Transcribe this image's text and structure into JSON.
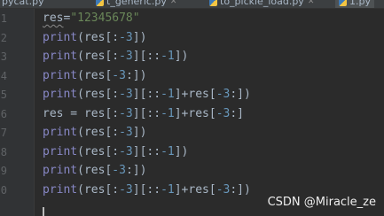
{
  "tabs": [
    {
      "label": "pycat.py"
    },
    {
      "label": "t_generic.py"
    },
    {
      "label": "to_pickle_load.py"
    },
    {
      "label": "1.py"
    }
  ],
  "gutter": {
    "line_numbers": [
      "1",
      "2",
      "3",
      "4",
      "5",
      "6",
      "7",
      "8",
      "9",
      "0"
    ]
  },
  "code_lines": [
    {
      "parts": [
        {
          "t": "res",
          "c": "plain",
          "squiggle": true
        },
        {
          "t": "=",
          "c": "plain"
        },
        {
          "t": "\"12345678\"",
          "c": "str"
        }
      ]
    },
    {
      "parts": [
        {
          "t": "print",
          "c": "fn"
        },
        {
          "t": "(res[:",
          "c": "plain"
        },
        {
          "t": "-3",
          "c": "num"
        },
        {
          "t": "])",
          "c": "plain"
        }
      ]
    },
    {
      "parts": [
        {
          "t": "print",
          "c": "fn"
        },
        {
          "t": "(res[:",
          "c": "plain"
        },
        {
          "t": "-3",
          "c": "num"
        },
        {
          "t": "][::",
          "c": "plain"
        },
        {
          "t": "-1",
          "c": "num"
        },
        {
          "t": "])",
          "c": "plain"
        }
      ]
    },
    {
      "parts": [
        {
          "t": "print",
          "c": "fn"
        },
        {
          "t": "(res[",
          "c": "plain"
        },
        {
          "t": "-3",
          "c": "num"
        },
        {
          "t": ":])",
          "c": "plain"
        }
      ]
    },
    {
      "parts": [
        {
          "t": "print",
          "c": "fn"
        },
        {
          "t": "(res[:",
          "c": "plain"
        },
        {
          "t": "-3",
          "c": "num"
        },
        {
          "t": "][::",
          "c": "plain"
        },
        {
          "t": "-1",
          "c": "num"
        },
        {
          "t": "]+res[",
          "c": "plain"
        },
        {
          "t": "-3",
          "c": "num"
        },
        {
          "t": ":])",
          "c": "plain"
        }
      ]
    },
    {
      "parts": [
        {
          "t": "res = res[:",
          "c": "plain"
        },
        {
          "t": "-3",
          "c": "num"
        },
        {
          "t": "][::",
          "c": "plain"
        },
        {
          "t": "-1",
          "c": "num"
        },
        {
          "t": "]+res[",
          "c": "plain"
        },
        {
          "t": "-3",
          "c": "num"
        },
        {
          "t": ":]",
          "c": "plain"
        }
      ]
    },
    {
      "parts": [
        {
          "t": "print",
          "c": "fn"
        },
        {
          "t": "(res[:",
          "c": "plain"
        },
        {
          "t": "-3",
          "c": "num"
        },
        {
          "t": "])",
          "c": "plain"
        }
      ]
    },
    {
      "parts": [
        {
          "t": "print",
          "c": "fn"
        },
        {
          "t": "(res[:",
          "c": "plain"
        },
        {
          "t": "-3",
          "c": "num"
        },
        {
          "t": "][::",
          "c": "plain"
        },
        {
          "t": "-1",
          "c": "num"
        },
        {
          "t": "])",
          "c": "plain"
        }
      ]
    },
    {
      "parts": [
        {
          "t": "print",
          "c": "fn"
        },
        {
          "t": "(res[",
          "c": "plain"
        },
        {
          "t": "-3",
          "c": "num"
        },
        {
          "t": ":])",
          "c": "plain"
        }
      ]
    },
    {
      "parts": [
        {
          "t": "print",
          "c": "fn"
        },
        {
          "t": "(res[:",
          "c": "plain"
        },
        {
          "t": "-3",
          "c": "num"
        },
        {
          "t": "][::",
          "c": "plain"
        },
        {
          "t": "-1",
          "c": "num"
        },
        {
          "t": "]+res[",
          "c": "plain"
        },
        {
          "t": "-3",
          "c": "num"
        },
        {
          "t": ":])",
          "c": "plain"
        }
      ]
    }
  ],
  "watermark": "CSDN @Miracle_ze",
  "colors": {
    "background": "#2b2b2b",
    "gutter": "#313335",
    "string": "#6a8759",
    "number": "#6897bb",
    "builtin": "#8888c6",
    "text": "#a9b7c6"
  },
  "icons": [
    "python-file-icon",
    "close-icon",
    "text-caret"
  ]
}
